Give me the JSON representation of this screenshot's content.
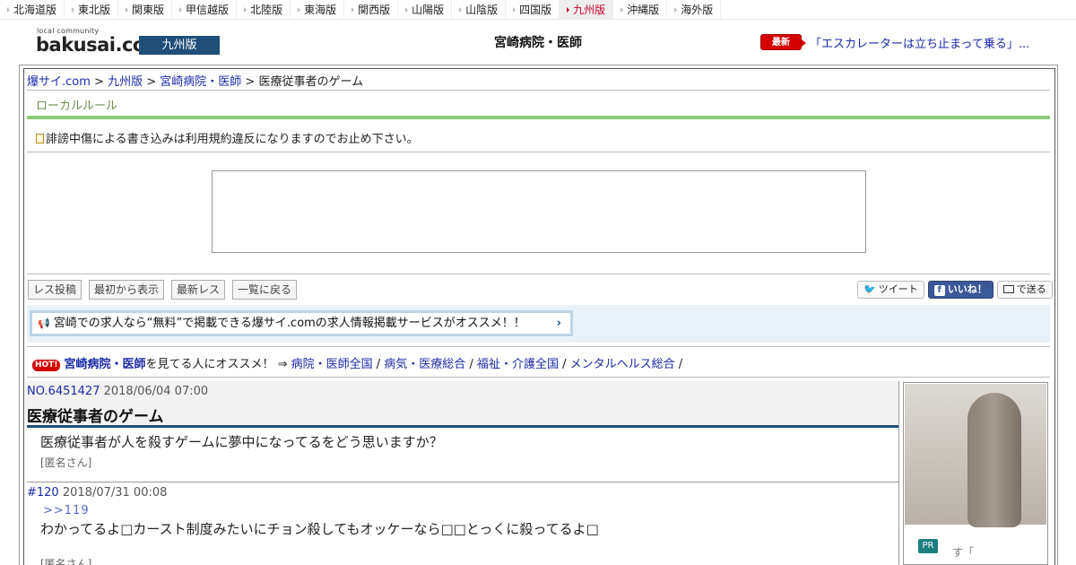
{
  "regions": [
    {
      "label": "北海道版",
      "active": false
    },
    {
      "label": "東北版",
      "active": false
    },
    {
      "label": "関東版",
      "active": false
    },
    {
      "label": "甲信越版",
      "active": false
    },
    {
      "label": "北陸版",
      "active": false
    },
    {
      "label": "東海版",
      "active": false
    },
    {
      "label": "関西版",
      "active": false
    },
    {
      "label": "山陽版",
      "active": false
    },
    {
      "label": "山陰版",
      "active": false
    },
    {
      "label": "四国版",
      "active": false
    },
    {
      "label": "九州版",
      "active": true
    },
    {
      "label": "沖縄版",
      "active": false
    },
    {
      "label": "海外版",
      "active": false
    }
  ],
  "header": {
    "logo_small": "local community",
    "logo_main": "bakusai.com",
    "region_badge": "九州版",
    "page_heading": "宮崎病院・医師",
    "news_badge": "最新NEWS",
    "news_link": "「エスカレーターは立ち止まって乗る」..."
  },
  "breadcrumb": {
    "home": "爆サイ.com",
    "region": "九州版",
    "board": "宮崎病院・医師",
    "sep": " > ",
    "current": "医療従事者のゲーム"
  },
  "local_rule": "ローカルルール",
  "notice": "誹謗中傷による書き込みは利用規約違反になりますのでお止め下さい。",
  "buttons": {
    "post": "レス投稿",
    "from_start": "最初から表示",
    "latest": "最新レス",
    "back": "一覧に戻る"
  },
  "share": {
    "tweet": "ツイート",
    "like": "いいね！",
    "send": "で送る"
  },
  "promo": "宮崎での求人なら“無料”で掲載できる爆サイ.comの求人情報掲載サービスがオススメ！！",
  "hot": {
    "badge": "HOT!",
    "name": "宮崎病院・医師",
    "text": "を見てる人にオススメ！ ⇒ ",
    "links": [
      "病院・医師全国",
      "病気・医療総合",
      "福祉・介護全国",
      "メンタルヘルス総合"
    ],
    "sep": " / "
  },
  "post": {
    "no": "NO.6451427",
    "date": "2018/06/04 07:00",
    "title": "医療従事者のゲーム",
    "body": "医療従事者が人を殺すゲームに夢中になってるをどう思いますか？",
    "author": "[匿名さん]"
  },
  "reply": {
    "no": "#120",
    "date": "2018/07/31 00:08",
    "anchor": ">>119",
    "body": "わかってるよ□カースト制度みたいにチョン殺してもオッケーなら□□とっくに殺ってるよ□",
    "author": "[匿名さん]"
  },
  "side_ad": {
    "pr": "PR",
    "text": "す「"
  },
  "colors": {
    "brand_blue": "#1f4e79",
    "active_region": "#d1002a",
    "local_rule_green": "#8fc97a",
    "hot_red": "#d40000"
  }
}
